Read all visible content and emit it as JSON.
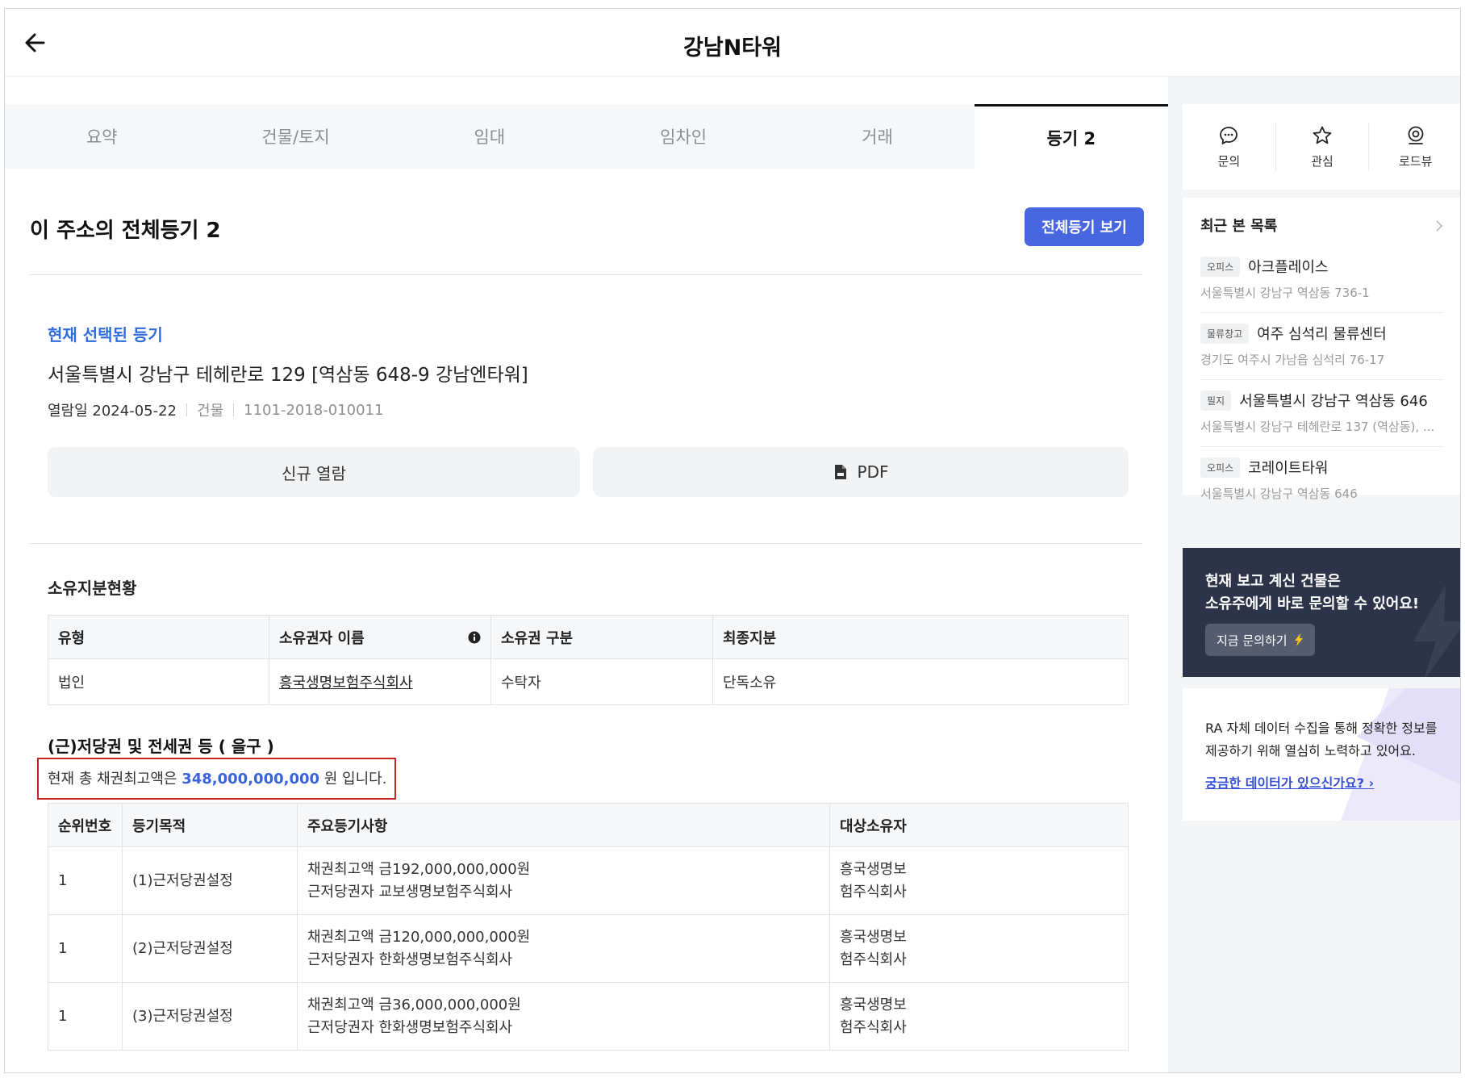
{
  "header": {
    "title": "강남N타워",
    "back_icon": "arrow-left-icon"
  },
  "tabs": [
    {
      "label": "요약",
      "active": false
    },
    {
      "label": "건물/토지",
      "active": false
    },
    {
      "label": "임대",
      "active": false
    },
    {
      "label": "임차인",
      "active": false
    },
    {
      "label": "거래",
      "active": false
    },
    {
      "label": "등기 2",
      "active": true
    }
  ],
  "main": {
    "section_title": "이 주소의 전체등기 2",
    "view_all_button": "전체등기 보기",
    "selected_label": "현재 선택된 등기",
    "address": "서울특별시 강남구 테헤란로 129 [역삼동 648-9 강남엔타워]",
    "meta": {
      "date": "열람일 2024-05-22",
      "type": "건물",
      "reg_no": "1101-2018-010011"
    },
    "new_view_button": "신규 열람",
    "pdf_button": "PDF"
  },
  "ownership": {
    "title": "소유지분현황",
    "columns": [
      "유형",
      "소유권자 이름",
      "소유권 구분",
      "최종지분"
    ],
    "rows": [
      {
        "type": "법인",
        "owner": "흥국생명보험주식회사",
        "kind": "수탁자",
        "share": "단독소유"
      }
    ]
  },
  "liens": {
    "title": "(근)저당권 및 전세권 등 ( 을구 )",
    "total_prefix": "현재 총 채권최고액은",
    "total_amount": "348,000,000,000",
    "total_suffix": "원 입니다.",
    "columns": [
      "순위번호",
      "등기목적",
      "주요등기사항",
      "대상소유자"
    ],
    "rows": [
      {
        "rank": "1",
        "purpose": "(1)근저당권설정",
        "detail1": "채권최고액 금192,000,000,000원",
        "detail2": "근저당권자 교보생명보험주식회사",
        "owner1": "흥국생명보",
        "owner2": "험주식회사"
      },
      {
        "rank": "1",
        "purpose": "(2)근저당권설정",
        "detail1": "채권최고액 금120,000,000,000원",
        "detail2": "근저당권자 한화생명보험주식회사",
        "owner1": "흥국생명보",
        "owner2": "험주식회사"
      },
      {
        "rank": "1",
        "purpose": "(3)근저당권설정",
        "detail1": "채권최고액 금36,000,000,000원",
        "detail2": "근저당권자 한화생명보험주식회사",
        "owner1": "흥국생명보",
        "owner2": "험주식회사"
      }
    ]
  },
  "sidebar": {
    "actions": [
      {
        "label": "문의",
        "icon": "chat-icon"
      },
      {
        "label": "관심",
        "icon": "star-icon"
      },
      {
        "label": "로드뷰",
        "icon": "location-pin-icon"
      }
    ],
    "recent": {
      "title": "최근 본 목록",
      "items": [
        {
          "badge": "오피스",
          "name": "아크플레이스",
          "address": "서울특별시 강남구 역삼동 736-1"
        },
        {
          "badge": "물류창고",
          "name": "여주 심석리 물류센터",
          "address": "경기도 여주시 가남읍 심석리 76-17"
        },
        {
          "badge": "필지",
          "name": "서울특별시 강남구 역삼동 646",
          "address": "서울특별시 강남구 테헤란로 137 (역삼동), ..."
        },
        {
          "badge": "오피스",
          "name": "코레이트타워",
          "address": "서울특별시 강남구 역삼동 646"
        }
      ]
    },
    "promo": {
      "line1": "현재 보고 계신 건물은",
      "line2": "소유주에게 바로 문의할 수 있어요!",
      "button": "지금 문의하기",
      "bolt_color": "#f5c518"
    },
    "ra": {
      "line1": "RA 자체 데이터 수집을 통해 정확한 정보를",
      "line2": "제공하기 위해 열심히 노력하고 있어요.",
      "link": "궁금한 데이터가 있으신가요?"
    }
  },
  "colors": {
    "accent": "#4866e0",
    "link_blue": "#2f6bdc",
    "highlight_red": "#c62323",
    "promo_bg": "#2d3348"
  }
}
